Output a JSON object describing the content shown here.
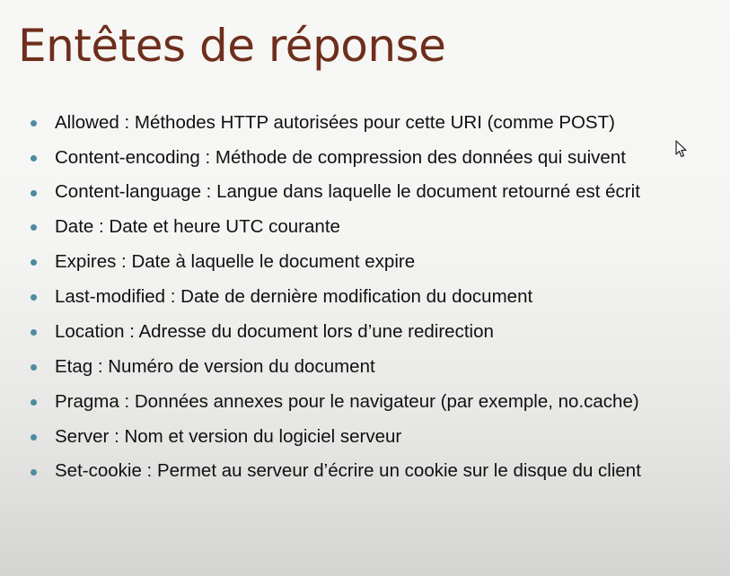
{
  "title": "Entêtes de réponse",
  "colors": {
    "title": "#6e2e1c",
    "bullet": "#4d8ba0",
    "text": "#111111"
  },
  "items": [
    "Allowed : Méthodes HTTP autorisées pour cette URI (comme POST)",
    "Content-encoding : Méthode de compression des données qui suivent",
    "Content-language  : Langue dans laquelle le document retourné est écrit",
    "Date : Date et heure UTC courante",
    "Expires : Date à laquelle le document expire",
    "Last-modified : Date de dernière modification du document",
    "Location :  Adresse du document lors d’une redirection",
    "Etag : Numéro de version du document",
    "Pragma : Données annexes pour le navigateur (par exemple, no.cache)",
    "Server : Nom et version du logiciel serveur",
    "Set-cookie : Permet au serveur d’écrire un cookie sur le disque du client"
  ],
  "cursor": {
    "icon": "mouse-pointer-icon"
  }
}
